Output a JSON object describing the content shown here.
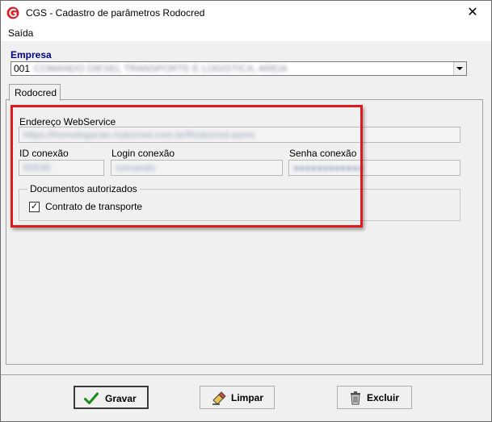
{
  "window": {
    "title": "CGS - Cadastro de parâmetros Rodocred",
    "close_glyph": "✕",
    "brand_color": "#d8232a"
  },
  "menu": {
    "items": [
      "Saída"
    ]
  },
  "empresa": {
    "label": "Empresa",
    "code": "001",
    "name": "COMANDO DIESEL TRANSPORTE E LOGISTICA, AREIA"
  },
  "tabs": [
    {
      "label": "Rodocred",
      "active": true
    }
  ],
  "form": {
    "webservice": {
      "label": "Endereço WebService",
      "value": "https://homologacao.rodocred.com.br/Rodocred.asmx"
    },
    "id_conexao": {
      "label": "ID conexão",
      "value": "00530"
    },
    "login_conexao": {
      "label": "Login conexão",
      "value": "comando"
    },
    "senha_conexao": {
      "label": "Senha conexão",
      "value": "●●●●●●●●●●●●"
    },
    "documentos": {
      "title": "Documentos autorizados",
      "contrato": {
        "label": "Contrato de transporte",
        "checked": true,
        "mark": "✓"
      }
    }
  },
  "buttons": {
    "gravar": {
      "label": "Gravar",
      "icon": "check-icon"
    },
    "limpar": {
      "label": "Limpar",
      "icon": "eraser-icon"
    },
    "excluir": {
      "label": "Excluir",
      "icon": "trash-icon"
    }
  },
  "colors": {
    "highlight": "#e0191f",
    "empresa_label": "#000080"
  }
}
